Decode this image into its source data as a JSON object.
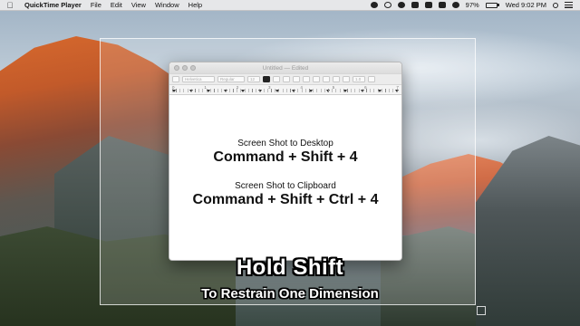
{
  "menubar": {
    "apple_icon": "apple-logo-icon",
    "app_name": "QuickTime Player",
    "items": [
      "File",
      "Edit",
      "View",
      "Window",
      "Help"
    ],
    "status_icons": [
      "menu-extra-icon",
      "screen-record-icon",
      "creative-cloud-icon",
      "airplay-icon",
      "volume-icon",
      "wifi-icon",
      "bluetooth-icon"
    ],
    "battery_percent": "97%",
    "battery_level": 0.97,
    "clock": "Wed 9:02 PM"
  },
  "window": {
    "title": "Untitled — Edited",
    "toolbar": {
      "font_family": "Helvetica",
      "font_style": "Regular",
      "font_size": "12",
      "text_color": "#222222",
      "line_spacing": "1.0"
    },
    "ruler_numbers": [
      "0",
      "1",
      "2",
      "3",
      "4",
      "5",
      "6",
      "7"
    ],
    "document": {
      "line1": "Screen Shot to Desktop",
      "line2": "Command + Shift + 4",
      "line3": "Screen Shot to Clipboard",
      "line4": "Command + Shift + Ctrl + 4"
    }
  },
  "caption": {
    "title": "Hold Shift",
    "subtitle": "To Restrain One Dimension"
  }
}
